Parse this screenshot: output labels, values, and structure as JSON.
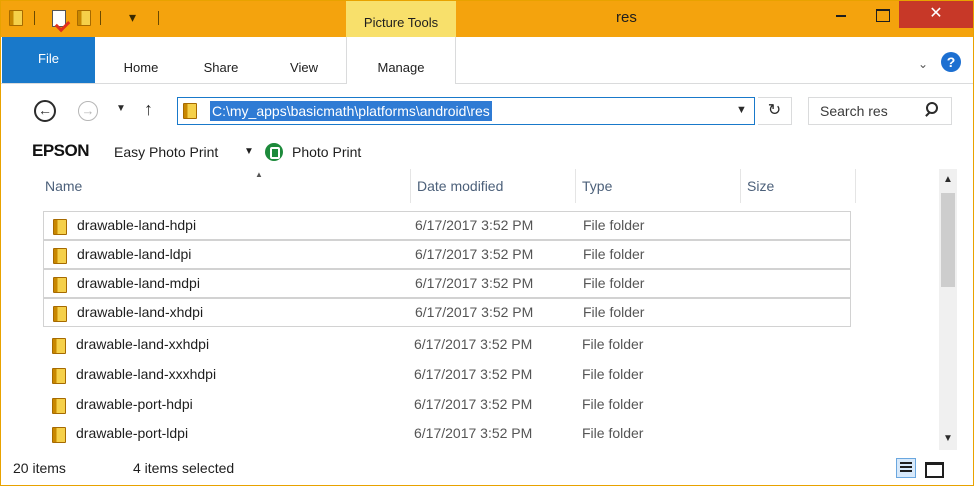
{
  "titlebar": {
    "contextual_header": "Picture Tools",
    "title": "res",
    "close_glyph": "✕",
    "quick_access_dropdown_glyph": "▾"
  },
  "ribbon": {
    "tabs": [
      {
        "id": "file",
        "label": "File"
      },
      {
        "id": "home",
        "label": "Home"
      },
      {
        "id": "share",
        "label": "Share"
      },
      {
        "id": "view",
        "label": "View"
      },
      {
        "id": "manage",
        "label": "Manage"
      }
    ],
    "expand_glyph": "⌄",
    "help_glyph": "?"
  },
  "navigation": {
    "back_glyph": "←",
    "forward_glyph": "→",
    "recent_glyph": "▼",
    "up_glyph": "↑",
    "address": "C:\\my_apps\\basicmath\\platforms\\android\\res",
    "address_dropdown_glyph": "▼",
    "refresh_glyph": "↻",
    "search_placeholder": "Search res"
  },
  "epson_toolbar": {
    "logo": "EPSON",
    "easy_photo_print": "Easy Photo Print",
    "dropdown_glyph": "▼",
    "photo_print": "Photo Print"
  },
  "columns": {
    "name": "Name",
    "date_modified": "Date modified",
    "type": "Type",
    "size": "Size",
    "sort_glyph": "▲"
  },
  "files": [
    {
      "name": "drawable-land-hdpi",
      "date": "6/17/2017 3:52 PM",
      "type": "File folder",
      "selected": true
    },
    {
      "name": "drawable-land-ldpi",
      "date": "6/17/2017 3:52 PM",
      "type": "File folder",
      "selected": true
    },
    {
      "name": "drawable-land-mdpi",
      "date": "6/17/2017 3:52 PM",
      "type": "File folder",
      "selected": true
    },
    {
      "name": "drawable-land-xhdpi",
      "date": "6/17/2017 3:52 PM",
      "type": "File folder",
      "selected": true
    },
    {
      "name": "drawable-land-xxhdpi",
      "date": "6/17/2017 3:52 PM",
      "type": "File folder",
      "selected": false
    },
    {
      "name": "drawable-land-xxxhdpi",
      "date": "6/17/2017 3:52 PM",
      "type": "File folder",
      "selected": false
    },
    {
      "name": "drawable-port-hdpi",
      "date": "6/17/2017 3:52 PM",
      "type": "File folder",
      "selected": false
    },
    {
      "name": "drawable-port-ldpi",
      "date": "6/17/2017 3:52 PM",
      "type": "File folder",
      "selected": false
    }
  ],
  "scrollbar": {
    "up_glyph": "▲",
    "down_glyph": "▼"
  },
  "status": {
    "item_count": "20 items",
    "selection": "4 items selected"
  },
  "colors": {
    "titlebar": "#f4a30d",
    "contextual_tab": "#f8e06b",
    "file_tab": "#1979ca",
    "close_button": "#c73828",
    "address_highlight": "#2f7bd4"
  }
}
